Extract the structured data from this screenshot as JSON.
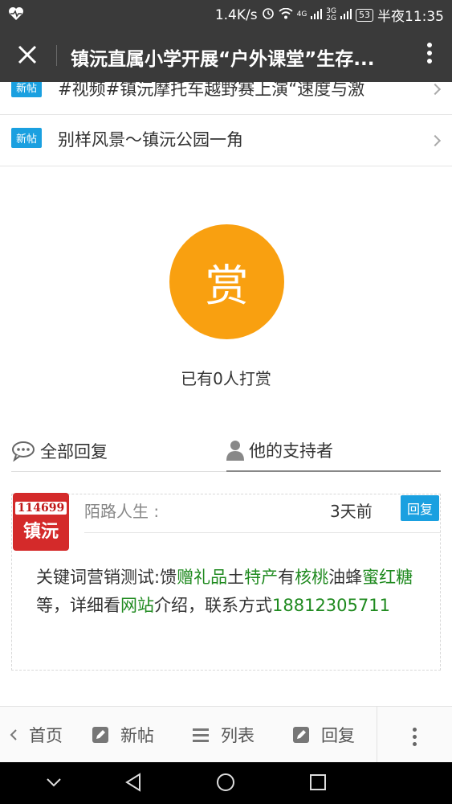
{
  "status_bar": {
    "speed": "1.4K/s",
    "net1": "4G",
    "net2": "3G",
    "net3": "2G",
    "battery": "53",
    "time": "半夜11:35"
  },
  "header": {
    "title": "镇沅直属小学开展“户外课堂”生存..."
  },
  "related_posts": [
    {
      "tag": "新帖",
      "title": "#视频#镇沅摩托车越野赛上演“速度与激"
    },
    {
      "tag": "新帖",
      "title": "别样风景～镇沅公园一角"
    }
  ],
  "reward": {
    "button_label": "赏",
    "count_text": "已有0人打赏"
  },
  "tabs": {
    "all_replies": "全部回复",
    "supporters": "他的支持者"
  },
  "reply": {
    "avatar_number": "114699",
    "avatar_name": "镇沅",
    "username": "陌路人生 :",
    "time": "3天前",
    "reply_label": "回复",
    "content": {
      "p1": "关键词营销测试:馈",
      "k1": "赠礼品",
      "p2": "土",
      "k2": "特产",
      "p3": "有",
      "k3": "核桃",
      "p4": "油蜂",
      "k4": "蜜红糖",
      "p5": "等，详细看",
      "k5": "网站",
      "p6": "介绍，联系方式",
      "k6": "18812305711"
    }
  },
  "toolbar": {
    "home": "首页",
    "new_post": "新帖",
    "list": "列表",
    "reply": "回复"
  },
  "colors": {
    "header_bg": "#3a3a3a",
    "reward_orange": "#f9a010",
    "tag_blue": "#1aa0e0",
    "link_green": "#1f8a1f"
  }
}
